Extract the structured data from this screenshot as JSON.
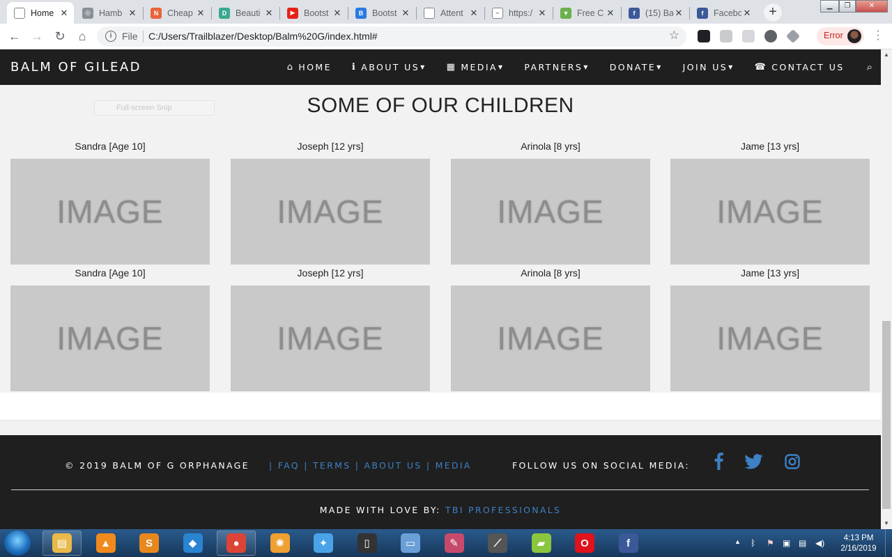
{
  "browser": {
    "tabs": [
      {
        "title": "Home",
        "favicon_color": "#ffffff",
        "favicon_glyph": "",
        "active": true
      },
      {
        "title": "Hamb",
        "favicon_color": "#8a8f96",
        "favicon_glyph": "◎"
      },
      {
        "title": "Cheap",
        "favicon_color": "#e8643c",
        "favicon_glyph": "N"
      },
      {
        "title": "Beauti",
        "favicon_color": "#3aa88f",
        "favicon_glyph": "D"
      },
      {
        "title": "Bootst",
        "favicon_color": "#e62117",
        "favicon_glyph": "▶"
      },
      {
        "title": "Bootst",
        "favicon_color": "#2a7ae2",
        "favicon_glyph": "B"
      },
      {
        "title": "Attent",
        "favicon_color": "#ffffff",
        "favicon_glyph": ""
      },
      {
        "title": "https:/",
        "favicon_color": "#ffffff",
        "favicon_glyph": "~"
      },
      {
        "title": "Free C",
        "favicon_color": "#6ab04c",
        "favicon_glyph": "▼"
      },
      {
        "title": "(15) Ba",
        "favicon_color": "#3b5998",
        "favicon_glyph": "f"
      },
      {
        "title": "Facebo",
        "favicon_color": "#3b5998",
        "favicon_glyph": "f"
      }
    ],
    "new_tab": "+",
    "file_label": "File",
    "url": "C:/Users/Trailblazer/Desktop/Balm%20G/index.html#",
    "error_chip": "Error"
  },
  "site": {
    "brand": "BALM OF GILEAD",
    "nav": [
      {
        "label": "HOME",
        "icon": "home-icon",
        "glyph": "⌂",
        "dropdown": false
      },
      {
        "label": "ABOUT US",
        "icon": "info-icon",
        "glyph": "ℹ",
        "dropdown": true
      },
      {
        "label": "MEDIA",
        "icon": "film-icon",
        "glyph": "▦",
        "dropdown": true
      },
      {
        "label": "PARTNERS",
        "icon": "",
        "glyph": "",
        "dropdown": true
      },
      {
        "label": "DONATE",
        "icon": "",
        "glyph": "",
        "dropdown": true
      },
      {
        "label": "JOIN US",
        "icon": "",
        "glyph": "",
        "dropdown": true
      },
      {
        "label": "CONTACT US",
        "icon": "phone-icon",
        "glyph": "☎",
        "dropdown": false
      }
    ],
    "snip_overlay": "Full-screen Snip",
    "section_title": "SOME OF OUR CHILDREN",
    "children_rows": [
      [
        {
          "name": "Sandra [Age 10]",
          "image_text": "IMAGE"
        },
        {
          "name": "Joseph [12 yrs]",
          "image_text": "IMAGE"
        },
        {
          "name": "Arinola [8 yrs]",
          "image_text": "IMAGE"
        },
        {
          "name": "Jame [13 yrs]",
          "image_text": "IMAGE"
        }
      ],
      [
        {
          "name": "Sandra [Age 10]",
          "image_text": "IMAGE"
        },
        {
          "name": "Joseph [12 yrs]",
          "image_text": "IMAGE"
        },
        {
          "name": "Arinola [8 yrs]",
          "image_text": "IMAGE"
        },
        {
          "name": "Jame [13 yrs]",
          "image_text": "IMAGE"
        }
      ]
    ],
    "footer": {
      "copyright": "© 2019 BALM OF G ORPHANAGE",
      "links": [
        "FAQ",
        "TERMS",
        "ABOUT US",
        "MEDIA"
      ],
      "follow_label": "FOLLOW US ON SOCIAL MEDIA:",
      "social": [
        "facebook-icon",
        "twitter-icon",
        "instagram-icon"
      ],
      "credit_label": "MADE WITH LOVE BY:",
      "credit_name": "TBI PROFESSIONALS"
    },
    "accent_color": "#3d80c4"
  },
  "taskbar": {
    "apps": [
      {
        "name": "explorer",
        "color": "#e9b94a",
        "glyph": "▤"
      },
      {
        "name": "vlc",
        "color": "#f08a1c",
        "glyph": "▲"
      },
      {
        "name": "sublime-text",
        "color": "#e8881c",
        "glyph": "S"
      },
      {
        "name": "vscode",
        "color": "#2a84d2",
        "glyph": "◆"
      },
      {
        "name": "chrome",
        "color": "#db4437",
        "glyph": "●"
      },
      {
        "name": "app-orange",
        "color": "#f0a030",
        "glyph": "✺"
      },
      {
        "name": "app-blue-bird",
        "color": "#4aa3e8",
        "glyph": "✦"
      },
      {
        "name": "app-phone",
        "color": "#333333",
        "glyph": "▯"
      },
      {
        "name": "app-book",
        "color": "#6a9fd8",
        "glyph": "▭"
      },
      {
        "name": "app-paint",
        "color": "#c84a6a",
        "glyph": "✎"
      },
      {
        "name": "app-mic",
        "color": "#555555",
        "glyph": "⟋"
      },
      {
        "name": "app-notes",
        "color": "#8cc63f",
        "glyph": "▰"
      },
      {
        "name": "opera",
        "color": "#e0121b",
        "glyph": "O"
      },
      {
        "name": "facebook",
        "color": "#3b5998",
        "glyph": "f"
      }
    ],
    "time": "4:13 PM",
    "date": "2/16/2019"
  }
}
